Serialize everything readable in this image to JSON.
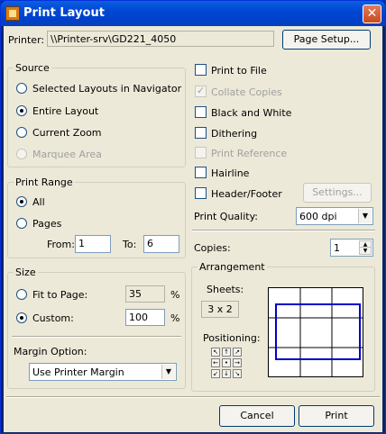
{
  "window": {
    "title": "Print Layout",
    "close_icon": "close-icon",
    "app_icon": "app-icon"
  },
  "printer": {
    "label": "Printer:",
    "value": "\\\\Printer-srv\\GD221_4050",
    "page_setup": "Page Setup..."
  },
  "source": {
    "title": "Source",
    "options": [
      {
        "label": "Selected Layouts in Navigator",
        "checked": false,
        "enabled": true
      },
      {
        "label": "Entire Layout",
        "checked": true,
        "enabled": true
      },
      {
        "label": "Current Zoom",
        "checked": false,
        "enabled": true
      },
      {
        "label": "Marquee Area",
        "checked": false,
        "enabled": false
      }
    ]
  },
  "print_range": {
    "title": "Print Range",
    "all": "All",
    "pages": "Pages",
    "from_label": "From:",
    "from_value": "1",
    "to_label": "To:",
    "to_value": "6"
  },
  "size": {
    "title": "Size",
    "fit_label": "Fit to Page:",
    "fit_value": "35",
    "custom_label": "Custom:",
    "custom_value": "100",
    "percent": "%",
    "margin_label": "Margin Option:",
    "margin_value": "Use Printer Margin"
  },
  "options": {
    "print_to_file": "Print to File",
    "collate_copies": "Collate Copies",
    "black_white": "Black and White",
    "dithering": "Dithering",
    "print_reference": "Print Reference",
    "hairline": "Hairline",
    "header_footer": "Header/Footer",
    "settings": "Settings...",
    "quality_label": "Print Quality:",
    "quality_value": "600 dpi",
    "copies_label": "Copies:",
    "copies_value": "1"
  },
  "arrangement": {
    "title": "Arrangement",
    "sheets_label": "Sheets:",
    "sheets_value": "3 x 2",
    "positioning_label": "Positioning:"
  },
  "footer": {
    "cancel": "Cancel",
    "print": "Print"
  }
}
